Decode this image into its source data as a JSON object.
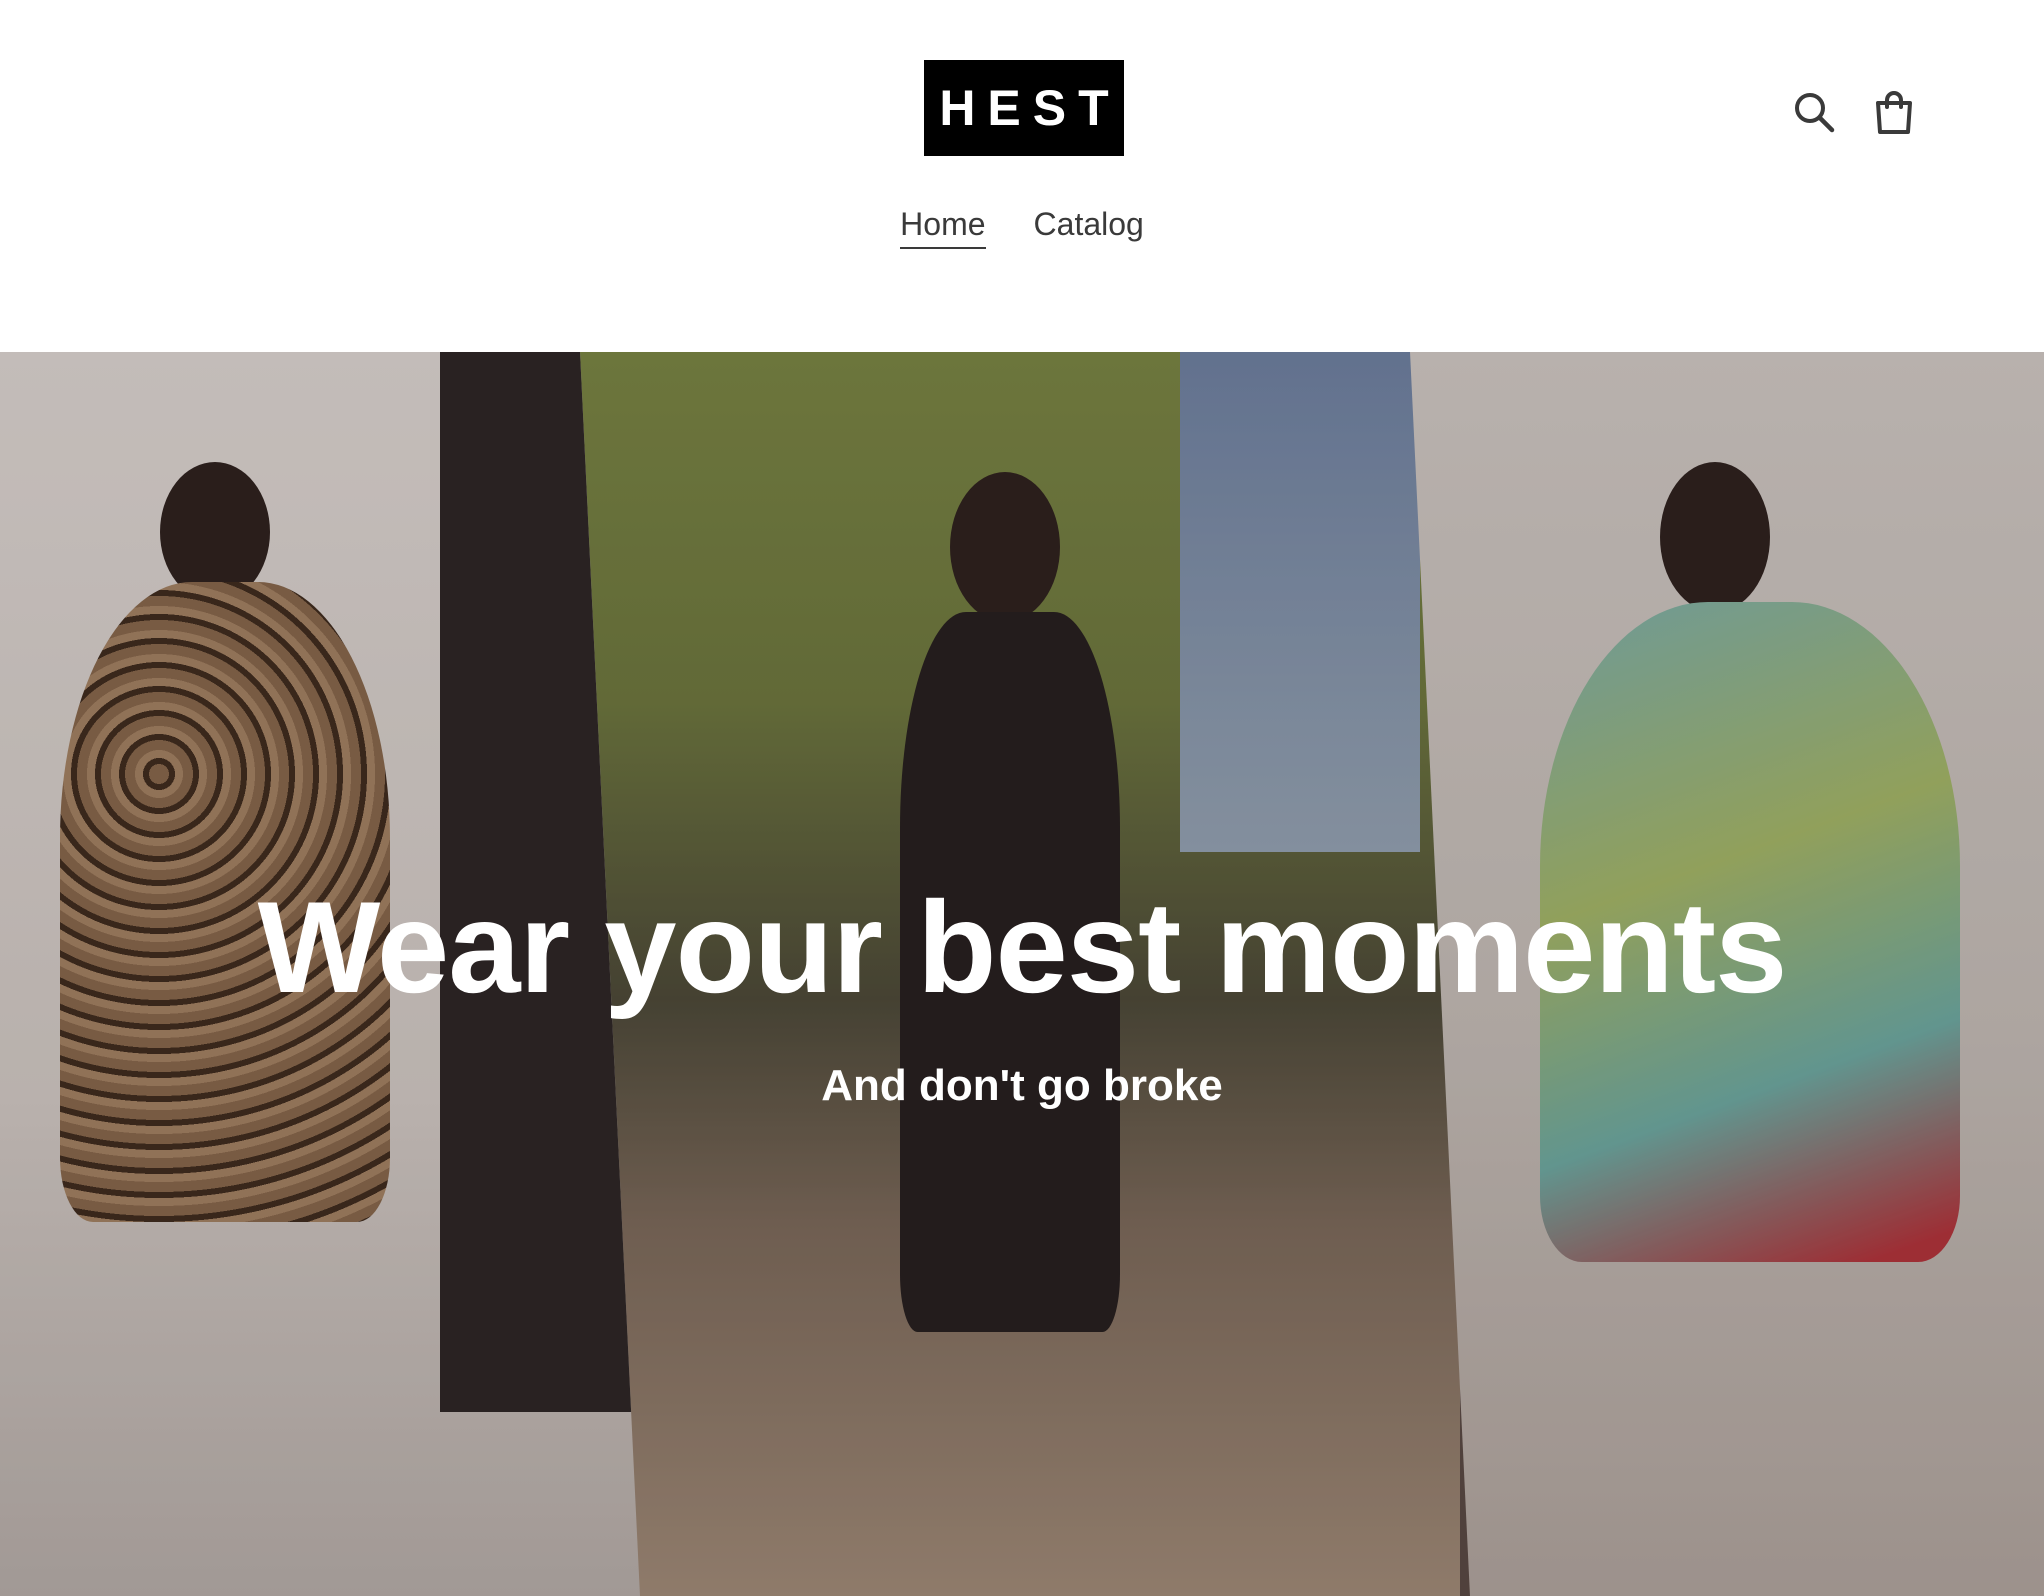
{
  "header": {
    "logo_text": "HEST",
    "icons": [
      "search-icon",
      "cart-icon"
    ]
  },
  "nav": {
    "items": [
      {
        "label": "Home",
        "active": true
      },
      {
        "label": "Catalog",
        "active": false
      }
    ]
  },
  "hero": {
    "title": "Wear your best moments",
    "subtitle": "And don't go broke"
  },
  "colors": {
    "text": "#3a3a3a",
    "logo_background": "#000000",
    "hero_text": "#ffffff"
  }
}
